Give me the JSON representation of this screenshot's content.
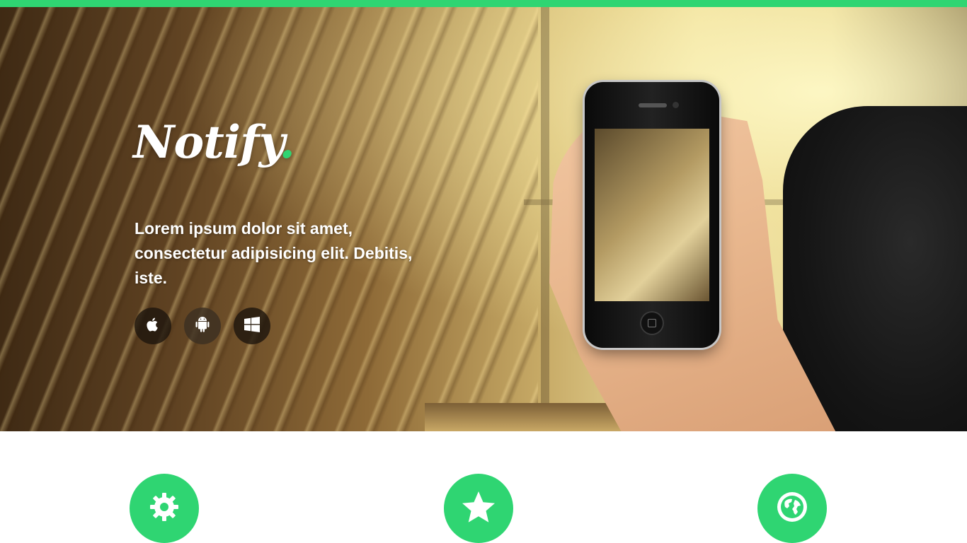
{
  "theme": {
    "accent": "#2fd572",
    "topbar": "#2fd572"
  },
  "brand": {
    "name": "Notify",
    "dot": "."
  },
  "hero": {
    "tagline": "Lorem ipsum dolor sit amet, consectetur adipisicing elit. Debitis, iste.",
    "platforms": [
      {
        "name": "apple-icon"
      },
      {
        "name": "android-icon"
      },
      {
        "name": "windows-icon"
      }
    ]
  },
  "features": [
    {
      "icon": "gear-icon"
    },
    {
      "icon": "star-icon"
    },
    {
      "icon": "globe-icon"
    }
  ]
}
